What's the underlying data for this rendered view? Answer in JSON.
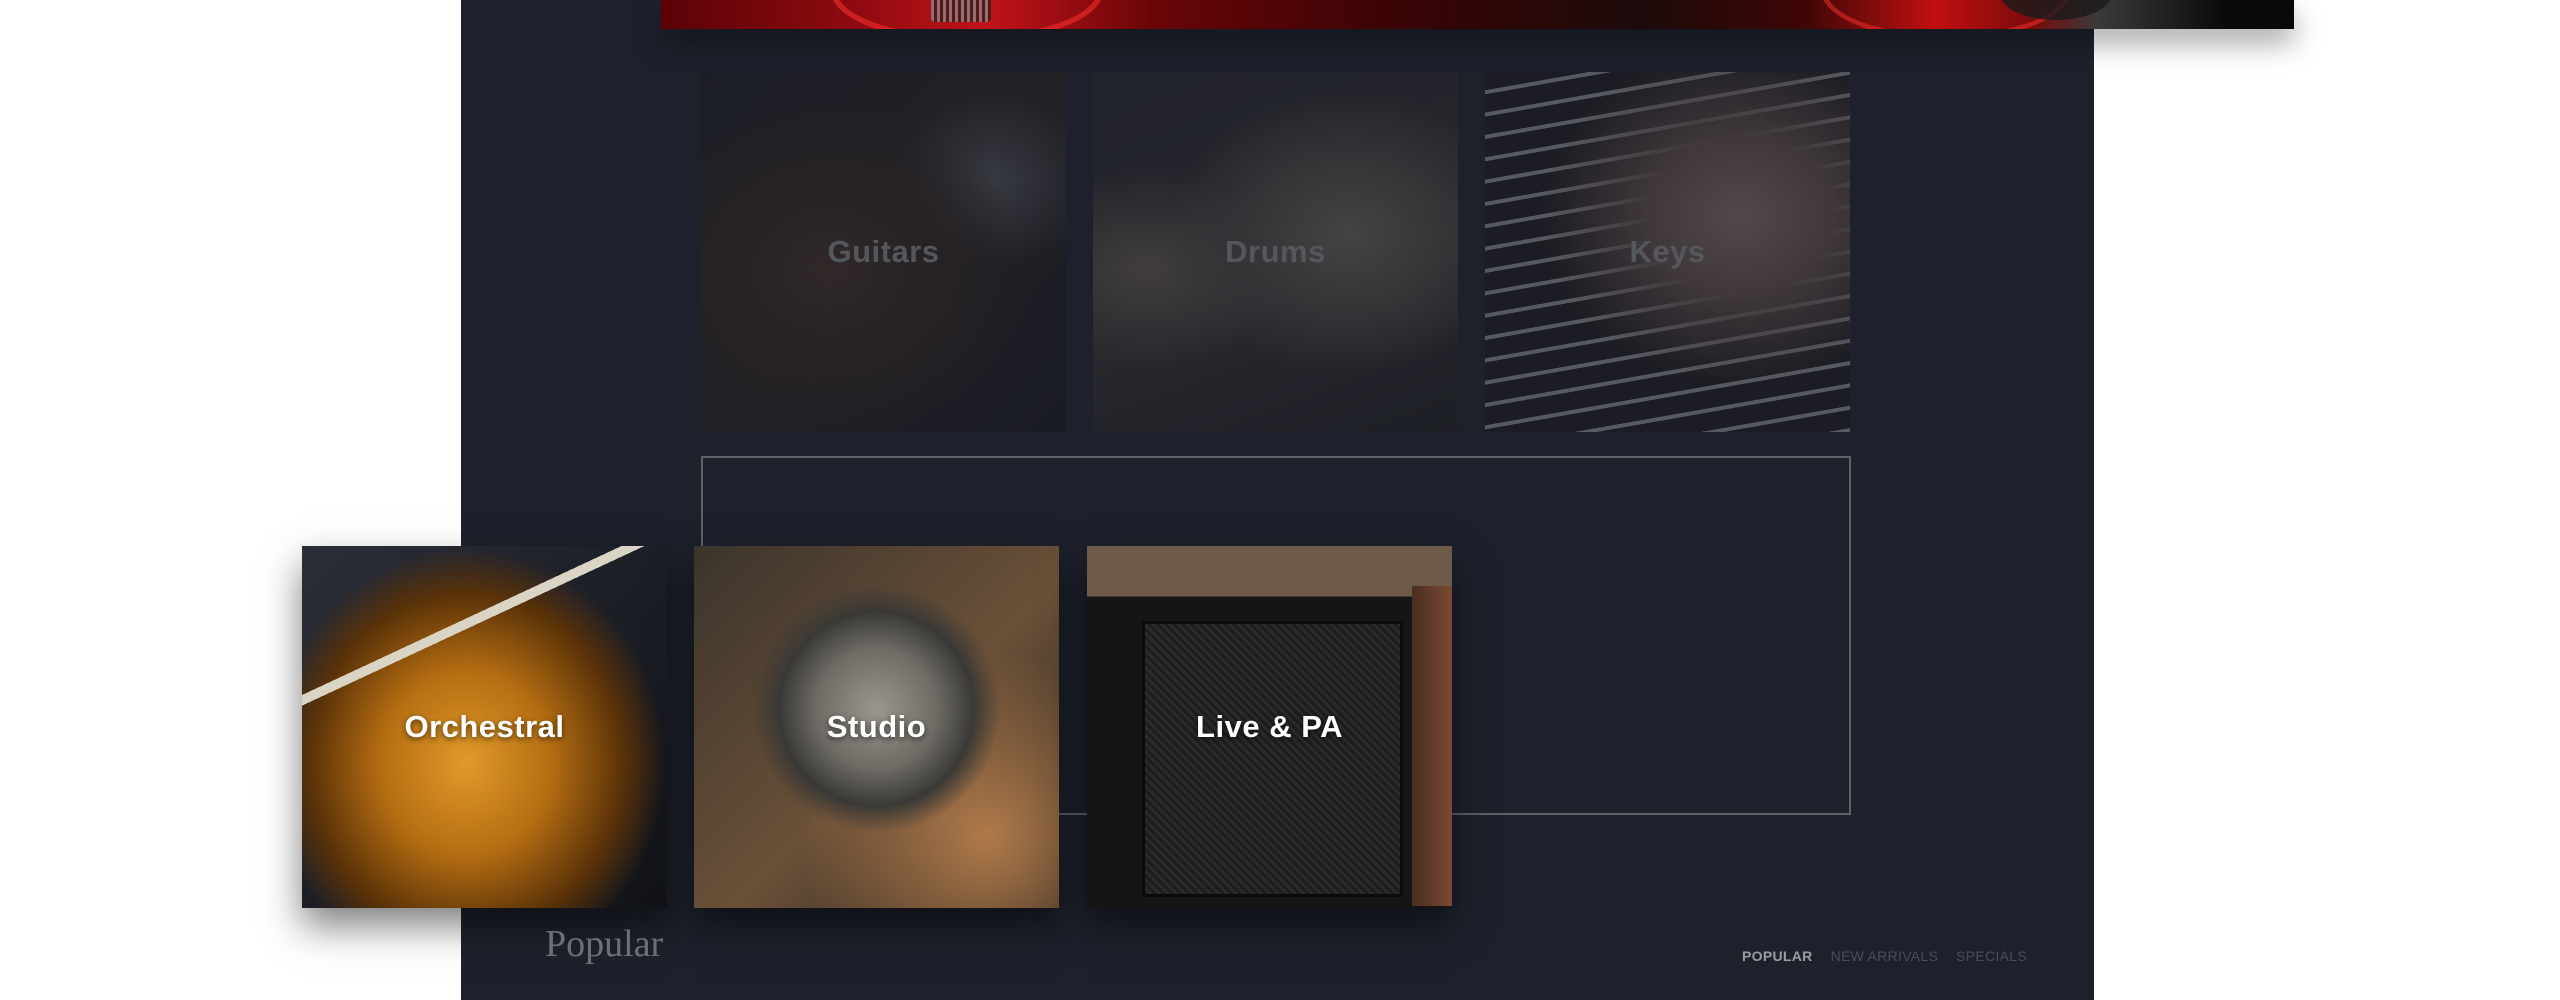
{
  "categories_top": [
    {
      "label": "Guitars",
      "image": "electric-guitar-photo"
    },
    {
      "label": "Drums",
      "image": "drum-kit-photo"
    },
    {
      "label": "Keys",
      "image": "piano-keys-photo"
    }
  ],
  "categories_bottom": [
    {
      "label": "Orchestral",
      "image": "violin-photo"
    },
    {
      "label": "Studio",
      "image": "studio-microphone-photo"
    },
    {
      "label": "Live & PA",
      "image": "guitar-amplifier-photo"
    }
  ],
  "popular": {
    "title": "Popular",
    "tabs": [
      {
        "label": "POPULAR",
        "active": true
      },
      {
        "label": "NEW ARRIVALS",
        "active": false
      },
      {
        "label": "SPECIALS",
        "active": false
      }
    ]
  },
  "colors": {
    "panel_bg": "#1e212c",
    "page_bg": "#ffffff",
    "frame_border": "#5e6068",
    "tab_active": "#9a9ca3",
    "tab_inactive": "#4a4d57"
  }
}
